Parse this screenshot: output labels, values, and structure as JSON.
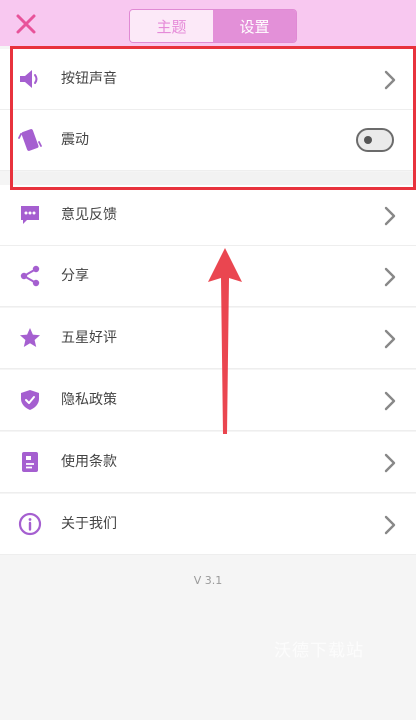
{
  "header": {
    "close_icon": "close-icon",
    "tabs": [
      {
        "label": "主题",
        "active": false
      },
      {
        "label": "设置",
        "active": true
      }
    ]
  },
  "settings": {
    "items": [
      {
        "label": "按钮声音",
        "icon": "speaker-icon",
        "control": "chevron"
      },
      {
        "label": "震动",
        "icon": "vibrate-phone-icon",
        "control": "toggle",
        "toggle_on": false
      },
      {
        "label": "意见反馈",
        "icon": "feedback-chat-icon",
        "control": "chevron"
      },
      {
        "label": "分享",
        "icon": "share-icon",
        "control": "chevron"
      },
      {
        "label": "五星好评",
        "icon": "star-icon",
        "control": "chevron"
      },
      {
        "label": "隐私政策",
        "icon": "shield-check-icon",
        "control": "chevron"
      },
      {
        "label": "使用条款",
        "icon": "document-icon",
        "control": "chevron"
      },
      {
        "label": "关于我们",
        "icon": "info-icon",
        "control": "chevron"
      }
    ]
  },
  "footer": {
    "version": "V 3.1",
    "watermark": "沃德下载站"
  },
  "colors": {
    "header_bg": "#f8c8f0",
    "accent": "#e390d8",
    "icon_purple": "#a55fd0",
    "close_pink": "#e8539a",
    "annotation_red": "#e8323d"
  }
}
